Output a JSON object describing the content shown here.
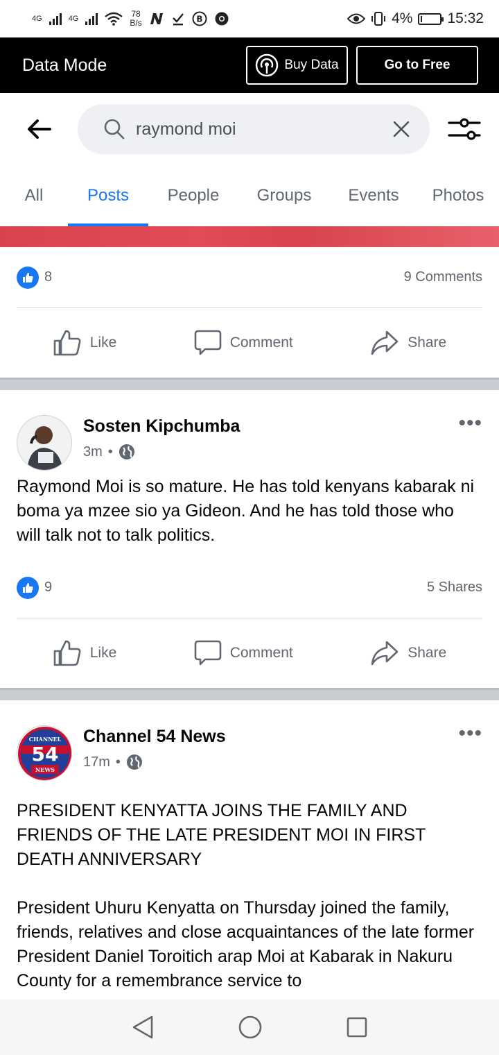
{
  "status_bar": {
    "network_left": "4G",
    "network_right": "4G",
    "speed": "78",
    "speed_unit": "B/s",
    "battery": "4%",
    "time": "15:32"
  },
  "data_bar": {
    "title": "Data Mode",
    "buy_label": "Buy Data",
    "free_label": "Go to Free"
  },
  "search": {
    "query": "raymond moi"
  },
  "tabs": [
    {
      "label": "All"
    },
    {
      "label": "Posts",
      "active": true
    },
    {
      "label": "People"
    },
    {
      "label": "Groups"
    },
    {
      "label": "Events"
    },
    {
      "label": "Photos"
    }
  ],
  "posts": [
    {
      "likes": "8",
      "stat_right": "9 Comments",
      "actions": {
        "like": "Like",
        "comment": "Comment",
        "share": "Share"
      }
    },
    {
      "author": "Sosten Kipchumba",
      "time": "3m",
      "separator": "•",
      "text": "Raymond Moi is so mature. He has told kenyans kabarak ni boma ya mzee sio ya Gideon. And he has told those who will talk not to talk politics.",
      "likes": "9",
      "stat_right": "5 Shares",
      "actions": {
        "like": "Like",
        "comment": "Comment",
        "share": "Share"
      }
    },
    {
      "author": "Channel 54 News",
      "time": "17m",
      "separator": "•",
      "logo_top": "CHANNEL",
      "logo_number": "54",
      "logo_bottom": "NEWS",
      "headline": "PRESIDENT KENYATTA JOINS THE FAMILY AND FRIENDS OF THE LATE PRESIDENT MOI IN FIRST DEATH ANNIVERSARY",
      "text": "President Uhuru Kenyatta on Thursday joined the family, friends, relatives and close acquaintances of the late former President Daniel Toroitich arap Moi at Kabarak in Nakuru County for a remembrance service to"
    }
  ],
  "colors": {
    "accent": "#1877f2",
    "data_bar": "#000000",
    "secondary_text": "#606770"
  }
}
